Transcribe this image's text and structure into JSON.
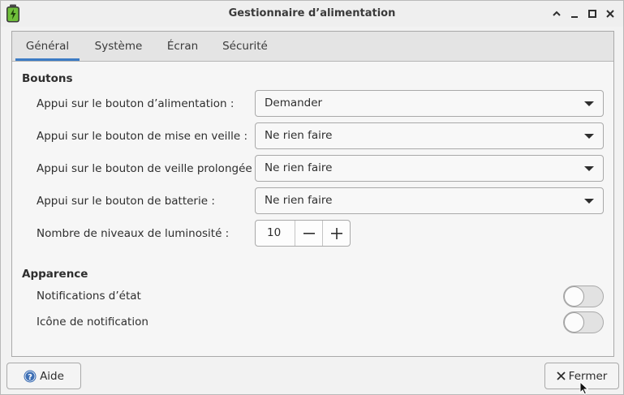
{
  "window": {
    "title": "Gestionnaire d’alimentation",
    "icon": "battery-icon"
  },
  "tabs": [
    {
      "label": "Général",
      "active": true
    },
    {
      "label": "Système",
      "active": false
    },
    {
      "label": "Écran",
      "active": false
    },
    {
      "label": "Sécurité",
      "active": false
    }
  ],
  "buttons_section": {
    "title": "Boutons",
    "rows": [
      {
        "label": "Appui sur le bouton d’alimentation :",
        "value": "Demander"
      },
      {
        "label": "Appui sur le bouton de mise en veille :",
        "value": "Ne rien faire"
      },
      {
        "label": "Appui sur le bouton de veille prolongée :",
        "value": "Ne rien faire"
      },
      {
        "label": "Appui sur le bouton de batterie :",
        "value": "Ne rien faire"
      }
    ],
    "brightness": {
      "label": "Nombre de niveaux de luminosité :",
      "value": "10"
    }
  },
  "appearance_section": {
    "title": "Apparence",
    "toggles": [
      {
        "label": "Notifications d’état",
        "on": false
      },
      {
        "label": "Icône de notification",
        "on": false
      }
    ]
  },
  "footer": {
    "help_label": "Aide",
    "close_label": "Fermer"
  },
  "colors": {
    "accent": "#3c7bc4",
    "battery_green": "#6fbf3a"
  }
}
